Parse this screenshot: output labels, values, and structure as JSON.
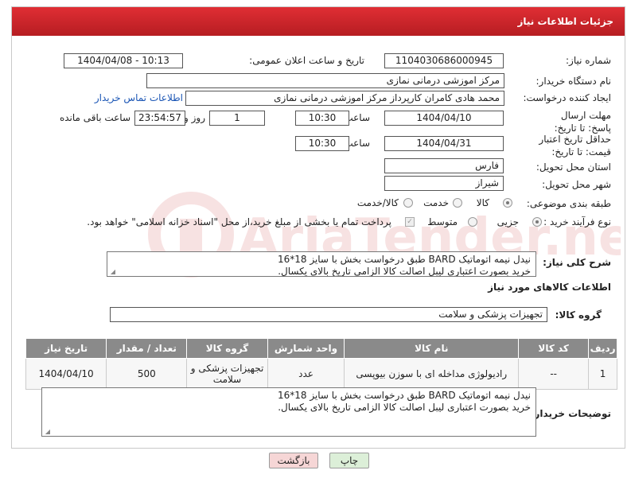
{
  "header": {
    "title": "جزئیات اطلاعات نیاز"
  },
  "fields": {
    "need_number_label": "شماره نیاز:",
    "need_number_value": "1104030686000945",
    "announce_label": "تاریخ و ساعت اعلان عمومی:",
    "announce_value": "1404/04/08 - 10:13",
    "buyer_org_label": "نام دستگاه خریدار:",
    "buyer_org_value": "مرکز اموزشی درمانی نمازی",
    "creator_label": "ایجاد کننده درخواست:",
    "creator_value": "محمد هادی کامران کارپرداز مرکز اموزشی درمانی نمازی",
    "contact_link": "اطلاعات تماس خریدار",
    "deadline_label": "مهلت ارسال پاسخ: تا تاریخ:",
    "deadline_date": "1404/04/10",
    "hour_label": "ساعت",
    "deadline_time": "10:30",
    "days_value": "1",
    "days_label": "روز و",
    "remaining_value": "23:54:57",
    "remaining_label": "ساعت باقی مانده",
    "min_price_label": "حداقل تاریخ اعتبار قیمت: تا تاریخ:",
    "min_price_date": "1404/04/31",
    "min_price_time": "10:30",
    "province_label": "استان محل تحویل:",
    "province_value": "فارس",
    "city_label": "شهر محل تحویل:",
    "city_value": "شیراز",
    "category_label": "طبقه بندی موضوعی:",
    "category_options": [
      "کالا",
      "خدمت",
      "کالا/خدمت"
    ],
    "category_selected": "کالا",
    "process_label": "نوع فرآیند خرید :",
    "process_options": [
      "جزیی",
      "متوسط"
    ],
    "process_selected": "جزیی",
    "payment_note": "پرداخت تمام یا بخشی از مبلغ خرید،از محل \"اسناد خزانه اسلامی\" خواهد بود."
  },
  "description": {
    "label": "شرح کلی نیاز:",
    "lines": [
      "نیدل نیمه اتوماتیک BARD طبق درخواست بخش با سایز 18*16",
      "خرید بصورت اعتباری لیبل اصالت کالا الزامی تاریخ بالای یکسال."
    ]
  },
  "goods_section": {
    "title": "اطلاعات کالاهای مورد نیاز",
    "group_label": "گروه کالا:",
    "group_value": "تجهیزات پزشکی و سلامت"
  },
  "table": {
    "headers": [
      "ردیف",
      "کد کالا",
      "نام کالا",
      "واحد شمارش",
      "گروه کالا",
      "تعداد / مقدار",
      "تاریخ نیاز"
    ],
    "rows": [
      [
        "1",
        "--",
        "رادیولوژی مداخله ای با سوزن بیوپسی",
        "عدد",
        "تجهیزات پزشکی و سلامت",
        "500",
        "1404/04/10"
      ]
    ]
  },
  "buyer_notes": {
    "label": "توضیحات خریدار:",
    "lines": [
      "نیدل نیمه اتوماتیک BARD طبق درخواست بخش با سایز 18*16",
      "خرید بصورت اعتباری لیبل اصالت کالا الزامی تاریخ بالای یکسال."
    ]
  },
  "buttons": {
    "print": "چاپ",
    "back": "بازگشت"
  },
  "watermark": {
    "text": "AriaTender.net"
  },
  "colors": {
    "header": "#c8262b",
    "table_header": "#8a8a8a",
    "link": "#1a55b5",
    "print_button": "#dcefd8",
    "back_button": "#f6d6d6"
  }
}
